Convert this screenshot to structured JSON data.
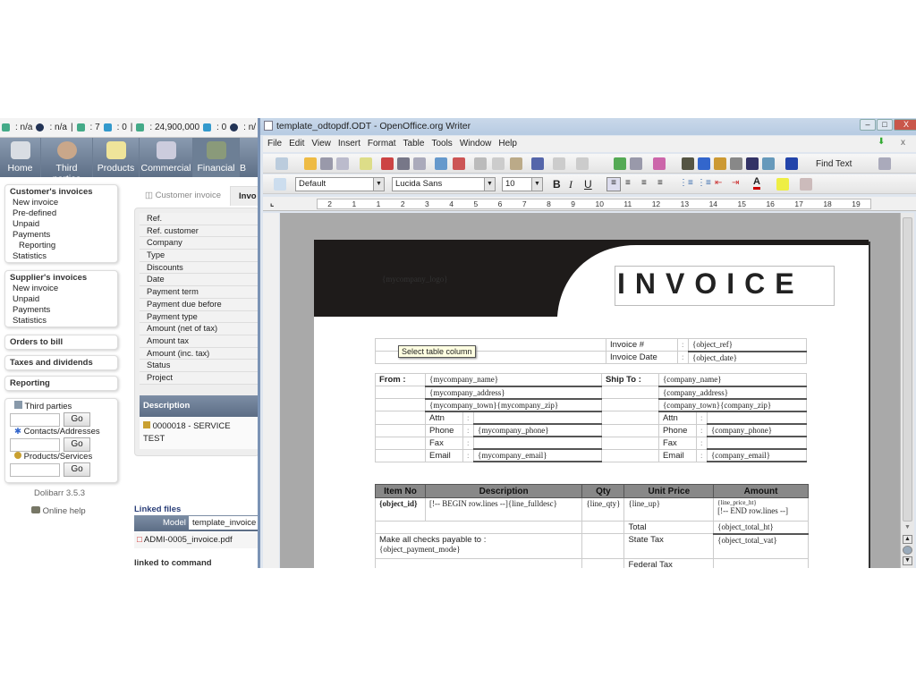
{
  "dolibarr": {
    "stats": [
      {
        "icon": "google-icon",
        "value": ": n/a"
      },
      {
        "icon": "info-icon",
        "value": ": n/a"
      },
      {
        "icon": "google-icon",
        "value": ": 7"
      },
      {
        "icon": "bing-icon",
        "value": ": 0"
      },
      {
        "icon": "google-icon",
        "value": ": 24,900,000"
      },
      {
        "icon": "bing-icon",
        "value": ": 0"
      },
      {
        "icon": "info-icon",
        "value": ": n/"
      }
    ],
    "nav": [
      "Home",
      "Third parties",
      "Products",
      "Commercial",
      "Financial",
      "B"
    ],
    "customer_invoices": {
      "title": "Customer's invoices",
      "items": [
        "New invoice",
        "Pre-defined",
        "Unpaid",
        "Payments",
        "Reporting",
        "Statistics"
      ]
    },
    "supplier_invoices": {
      "title": "Supplier's invoices",
      "items": [
        "New invoice",
        "Unpaid",
        "Payments",
        "Statistics"
      ]
    },
    "sections": [
      "Orders to bill",
      "Taxes and dividends",
      "Reporting"
    ],
    "search": [
      {
        "label": "Third parties",
        "go": "Go"
      },
      {
        "label": "Contacts/Addresses",
        "go": "Go"
      },
      {
        "label": "Products/Services",
        "go": "Go"
      }
    ],
    "version": "Dolibarr 3.5.3",
    "help": "Online help",
    "tabs": [
      "Customer invoice",
      "Invo"
    ],
    "fields": [
      "Ref.",
      "Ref. customer",
      "Company",
      "Type",
      "Discounts",
      "Date",
      "Payment term",
      "Payment due before",
      "Payment type",
      "Amount (net of tax)",
      "Amount tax",
      "Amount (inc. tax)",
      "Status",
      "Project"
    ],
    "description_header": "Description",
    "description_line1": "0000018 - SERVICE",
    "description_line2": "TEST",
    "linked_files": "Linked files",
    "model_label": "Model",
    "model_value": "template_invoice",
    "pdf_file": "ADMI-0005_invoice.pdf",
    "linked_to": "linked to command"
  },
  "writer": {
    "title": "template_odtopdf.ODT - OpenOffice.org Writer",
    "menu": [
      "File",
      "Edit",
      "View",
      "Insert",
      "Format",
      "Table",
      "Tools",
      "Window",
      "Help"
    ],
    "find_text": "Find Text",
    "style": "Default",
    "font": "Lucida Sans",
    "size": "10",
    "ruler": [
      "2",
      "1",
      "1",
      "2",
      "3",
      "4",
      "5",
      "6",
      "7",
      "8",
      "9",
      "10",
      "11",
      "12",
      "13",
      "14",
      "15",
      "16",
      "17",
      "18",
      "19"
    ],
    "tooltip": "Select table column",
    "doc": {
      "logo": "{mycompany_logo}",
      "heading": "INVOICE",
      "invoice_no_label": "Invoice #",
      "invoice_no": "{object_ref}",
      "invoice_date_label": "Invoice Date",
      "invoice_date": "{object_date}",
      "colon": ":",
      "from": "From :",
      "ship_to": "Ship To :",
      "from_lines": [
        "{mycompany_name}",
        "{mycompany_address}",
        "{mycompany_town}{mycompany_zip}"
      ],
      "to_lines": [
        "{company_name}",
        "{company_address}",
        "{company_town}{company_zip}"
      ],
      "contact_labels": [
        "Attn",
        "Phone",
        "Fax",
        "Email"
      ],
      "from_contacts": [
        "",
        "{mycompany_phone}",
        "",
        "{mycompany_email}"
      ],
      "to_contacts": [
        "",
        "{company_phone}",
        "",
        "{company_email}"
      ],
      "item_headers": [
        "Item No",
        "Description",
        "Qty",
        "Unit Price",
        "Amount"
      ],
      "item_row": [
        "{object_id}",
        "[!-- BEGIN row.lines --]{line_fulldesc}",
        "{line_qty}",
        "{line_up}",
        "{line_price_ht}",
        "[!-- END row.lines --]"
      ],
      "total_label": "Total",
      "total": "{object_total_ht}",
      "checks": "Make all checks payable to :",
      "payment_mode": "{object_payment_mode}",
      "state_tax_label": "State Tax",
      "state_tax": "{object_total_vat}",
      "federal_tax_label": "Federal Tax"
    }
  }
}
